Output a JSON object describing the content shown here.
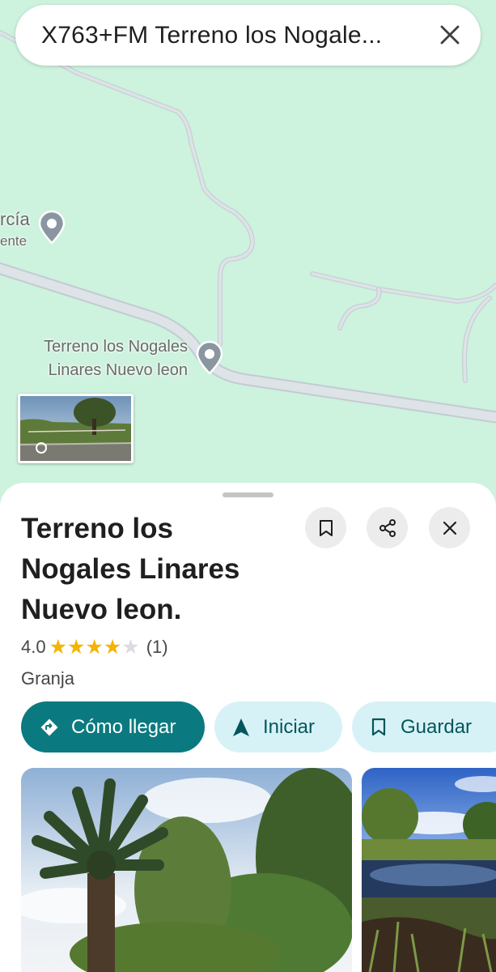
{
  "search": {
    "query": "X763+FM Terreno los Nogale..."
  },
  "map": {
    "partial_label_line1": "rcía",
    "partial_label_line2": "ente",
    "pin_label": [
      "Terreno los Nogales",
      "Linares Nuevo leon"
    ]
  },
  "place": {
    "title": "Terreno los Nogales Linares Nuevo leon.",
    "rating": "4.0",
    "stars": 4,
    "stars_max": 5,
    "review_count": "(1)",
    "category": "Granja"
  },
  "actions": {
    "directions": "Cómo llegar",
    "start": "Iniciar",
    "save": "Guardar"
  },
  "icons": {
    "search_close": "close-icon",
    "bookmark": "bookmark-icon",
    "share": "share-icon",
    "sheet_close": "close-icon",
    "directions": "directions-icon",
    "navigation": "navigation-arrow-icon",
    "save": "bookmark-icon",
    "street_view": "street-view-rotate-icon",
    "pin": "map-pin-icon"
  },
  "colors": {
    "map_background": "#cdf2de",
    "road": "#d6dde2",
    "primary": "#0b7a80",
    "secondary_button": "#d7f2f7",
    "star": "#f4b400",
    "star_empty": "#dadce0"
  }
}
